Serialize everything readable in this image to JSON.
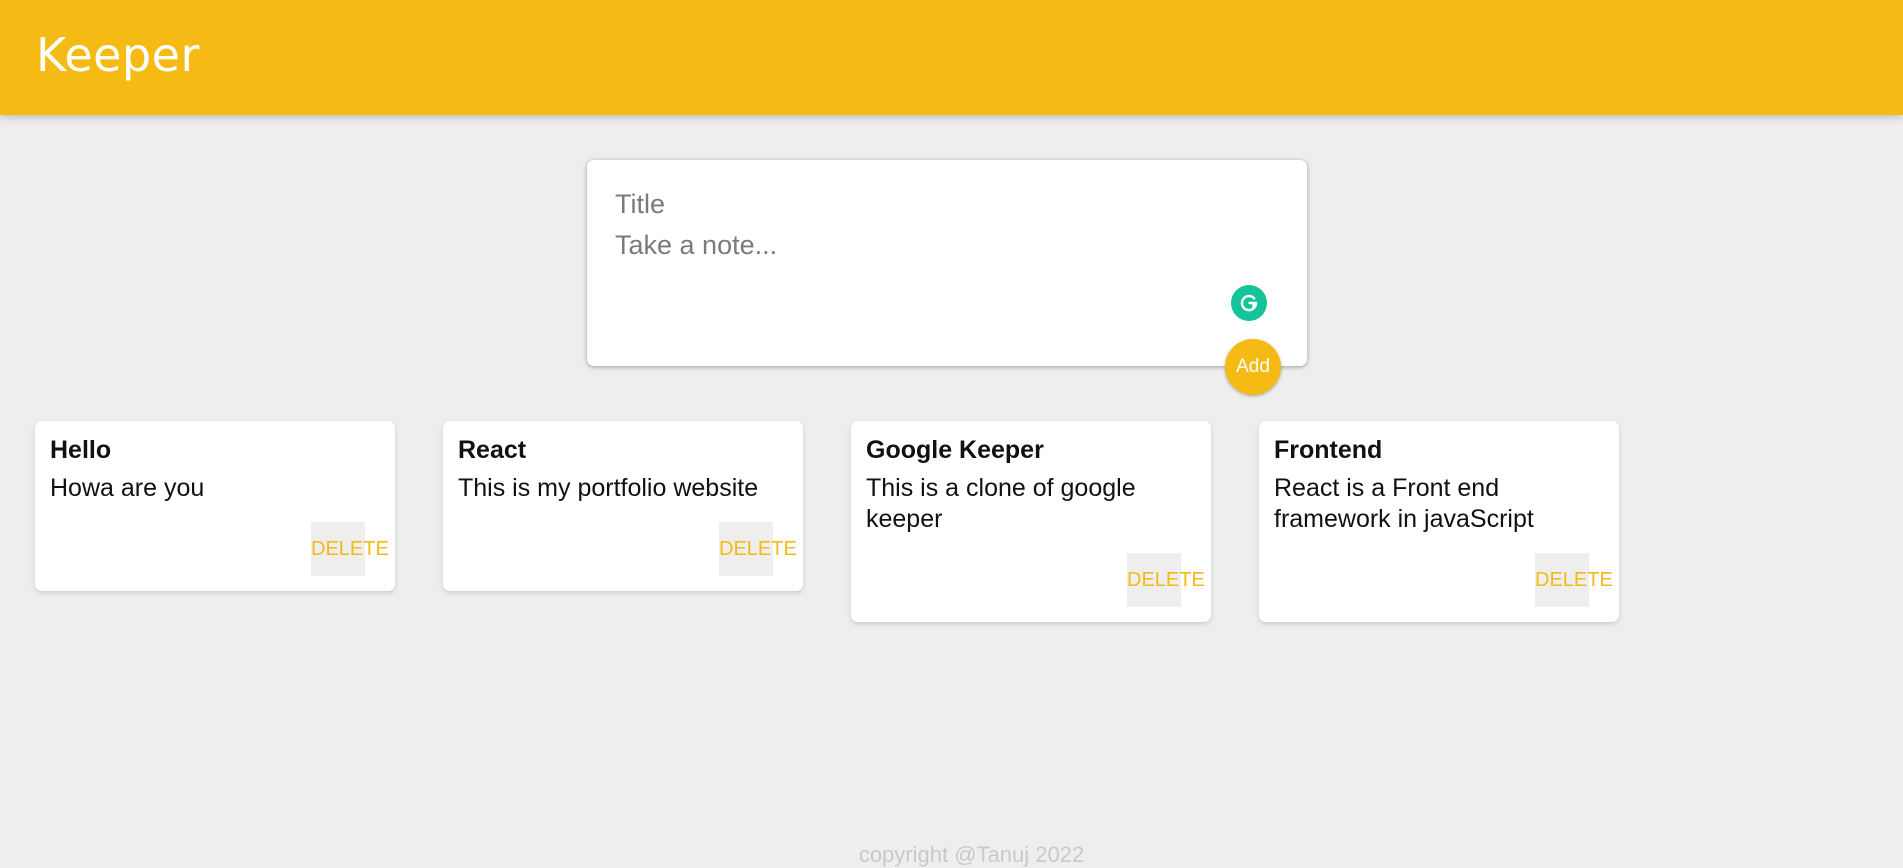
{
  "header": {
    "title": "Keeper"
  },
  "create_area": {
    "title_placeholder": "Title",
    "content_placeholder": "Take a note...",
    "add_label": "Add"
  },
  "notes": [
    {
      "title": "Hello",
      "content": "Howa are you",
      "delete_label": "DELETE"
    },
    {
      "title": "React",
      "content": "This is my portfolio website",
      "delete_label": "DELETE"
    },
    {
      "title": "Google Keeper",
      "content": "This is a clone of google keeper",
      "delete_label": "DELETE"
    },
    {
      "title": "Frontend",
      "content": "React is a Front end framework in javaScript",
      "delete_label": "DELETE"
    }
  ],
  "footer": {
    "text": "copyright @Tanuj 2022"
  },
  "colors": {
    "accent": "#f5ba13",
    "background": "#eeeeee",
    "grammarly": "#15c39a"
  },
  "icons": {
    "grammarly": "grammarly-icon"
  }
}
